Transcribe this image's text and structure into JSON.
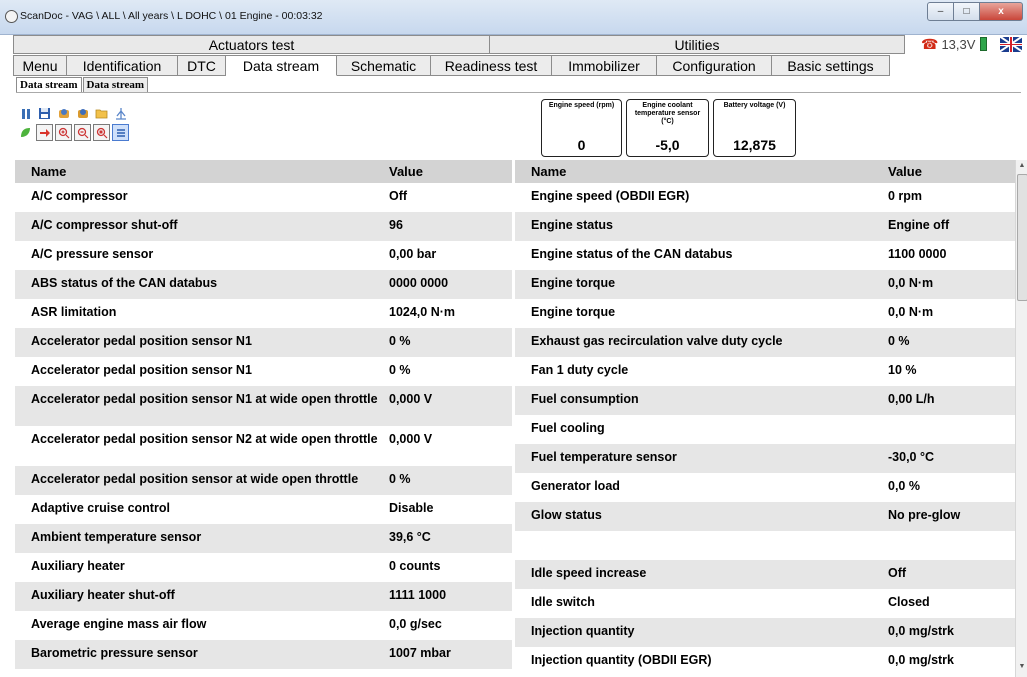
{
  "window": {
    "title": "ScanDoc - VAG \\ ALL \\ All years \\ L DOHC \\ 01 Engine - 00:03:32",
    "buttons": {
      "minimize": "–",
      "maximize": "□",
      "close": "x"
    }
  },
  "header": {
    "actuators": "Actuators test",
    "utilities": "Utilities"
  },
  "status": {
    "voltage": "13,3V",
    "phone_icon": "☎"
  },
  "tabs": [
    {
      "label": "Menu"
    },
    {
      "label": "Identification"
    },
    {
      "label": "DTC"
    },
    {
      "label": "Data stream"
    },
    {
      "label": "Schematic"
    },
    {
      "label": "Readiness test"
    },
    {
      "label": "Immobilizer"
    },
    {
      "label": "Configuration"
    },
    {
      "label": "Basic settings"
    }
  ],
  "subtabs": [
    {
      "label": "Data stream"
    },
    {
      "label": "Data stream"
    }
  ],
  "toolbar": {
    "row1": [
      "pause-icon",
      "save-icon",
      "record-icon",
      "playback-icon",
      "folder-icon",
      "graph-icon"
    ],
    "row2": [
      "leaf-icon",
      "export-icon",
      "zoom-in-icon",
      "zoom-out-icon",
      "zoom-fit-icon",
      "list-view-icon"
    ]
  },
  "gauges": [
    {
      "label": "Engine speed  (rpm)",
      "value": "0"
    },
    {
      "label": "Engine coolant temperature sensor (°C)",
      "value": "-5,0"
    },
    {
      "label": "Battery voltage  (V)",
      "value": "12,875"
    }
  ],
  "left_table": {
    "headers": {
      "name": "Name",
      "value": "Value"
    },
    "rows": [
      {
        "name": "A/C compressor",
        "value": "Off"
      },
      {
        "name": "A/C compressor shut-off",
        "value": "96"
      },
      {
        "name": "A/C pressure sensor",
        "value": "0,00 bar"
      },
      {
        "name": "ABS status of the CAN databus",
        "value": "0000 0000"
      },
      {
        "name": "ASR limitation",
        "value": "1024,0 N·m"
      },
      {
        "name": "Accelerator pedal position sensor N1",
        "value": "0 %"
      },
      {
        "name": "Accelerator pedal position sensor N1",
        "value": "0 %"
      },
      {
        "name": "Accelerator pedal position sensor N1 at wide open throttle",
        "value": "0,000 V"
      },
      {
        "name": "Accelerator pedal position sensor N2 at wide open throttle",
        "value": "0,000 V"
      },
      {
        "name": "Accelerator pedal position sensor at wide open throttle",
        "value": "0 %"
      },
      {
        "name": "Adaptive cruise control",
        "value": "Disable"
      },
      {
        "name": "Ambient temperature sensor",
        "value": "39,6 °C"
      },
      {
        "name": "Auxiliary heater",
        "value": "0 counts"
      },
      {
        "name": "Auxiliary heater shut-off",
        "value": "1111 1000"
      },
      {
        "name": "Average engine mass air flow",
        "value": "0,0 g/sec"
      },
      {
        "name": "Barometric pressure sensor",
        "value": "1007 mbar"
      }
    ]
  },
  "right_table": {
    "headers": {
      "name": "Name",
      "value": "Value"
    },
    "rows": [
      {
        "name": "Engine speed (OBDII EGR)",
        "value": "0 rpm"
      },
      {
        "name": "Engine status",
        "value": "Engine off"
      },
      {
        "name": "Engine status of the CAN databus",
        "value": "1100 0000"
      },
      {
        "name": "Engine torque",
        "value": "0,0 N·m"
      },
      {
        "name": "Engine torque",
        "value": "0,0 N·m"
      },
      {
        "name": "Exhaust gas recirculation valve duty cycle",
        "value": "0 %"
      },
      {
        "name": "Fan 1 duty cycle",
        "value": "10 %"
      },
      {
        "name": "Fuel consumption",
        "value": "0,00 L/h"
      },
      {
        "name": "Fuel cooling",
        "value": ""
      },
      {
        "name": "Fuel temperature sensor",
        "value": "-30,0 °C"
      },
      {
        "name": "Generator load",
        "value": "0,0 %"
      },
      {
        "name": "Glow status",
        "value": "No pre-glow"
      },
      {
        "name": "",
        "value": ""
      },
      {
        "name": "Idle speed increase",
        "value": "Off"
      },
      {
        "name": "Idle switch",
        "value": "Closed"
      },
      {
        "name": "Injection quantity",
        "value": "0,0 mg/strk"
      },
      {
        "name": "Injection quantity (OBDII EGR)",
        "value": "0,0 mg/strk"
      }
    ]
  }
}
